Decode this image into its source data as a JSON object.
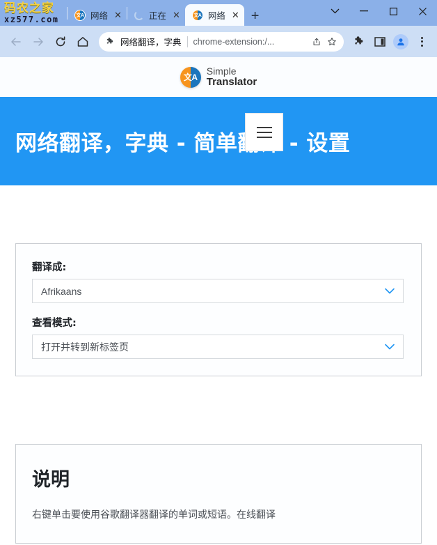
{
  "browser": {
    "watermark": {
      "line1": "码农之家",
      "line2": "xz577.com"
    },
    "tabs": [
      {
        "title": "网络",
        "favicon": "translator-icon",
        "close_label": "✕",
        "active": false,
        "loading": false
      },
      {
        "title": "正在",
        "favicon": "loading-spinner",
        "close_label": "✕",
        "active": false,
        "loading": true
      },
      {
        "title": "网络",
        "favicon": "translator-icon",
        "close_label": "✕",
        "active": true,
        "loading": false
      }
    ],
    "new_tab_label": "+",
    "window_controls": {
      "tab_search": "tab-search-chevron-icon",
      "minimize": "minimize-icon",
      "maximize": "maximize-icon",
      "close": "close-icon"
    },
    "toolbar": {
      "back": "back-arrow-icon",
      "forward": "forward-arrow-icon",
      "reload": "reload-icon",
      "home": "home-icon",
      "extensions": "puzzle-piece-icon",
      "side_panel": "side-panel-icon",
      "profile": "avatar-icon",
      "menu": "three-dot-menu-icon"
    },
    "omnibox": {
      "extension_icon": "puzzle-piece-icon",
      "extension_name": "网络翻译，字典",
      "url": "chrome-extension:/...",
      "share_icon": "share-icon",
      "bookmark_icon": "star-icon"
    }
  },
  "page": {
    "brand": {
      "logo": "simple-translator-logo",
      "line1": "Simple",
      "line2": "Translator"
    },
    "menu_button": "hamburger-menu-icon",
    "hero_title": "网络翻译，字典 - 简单翻译 - 设置",
    "settings": {
      "target_language": {
        "label": "翻译成:",
        "value": "Afrikaans"
      },
      "view_mode": {
        "label": "查看模式:",
        "value": "打开并转到新标签页"
      }
    },
    "info": {
      "title": "说明",
      "text": "右键单击要使用谷歌翻译器翻译的单词或短语。在线翻译"
    }
  },
  "colors": {
    "hero_blue": "#2196f3",
    "tabstrip": "#8bb0e8",
    "toolbar": "#cddef5",
    "accent_chevron": "#2196f3"
  }
}
